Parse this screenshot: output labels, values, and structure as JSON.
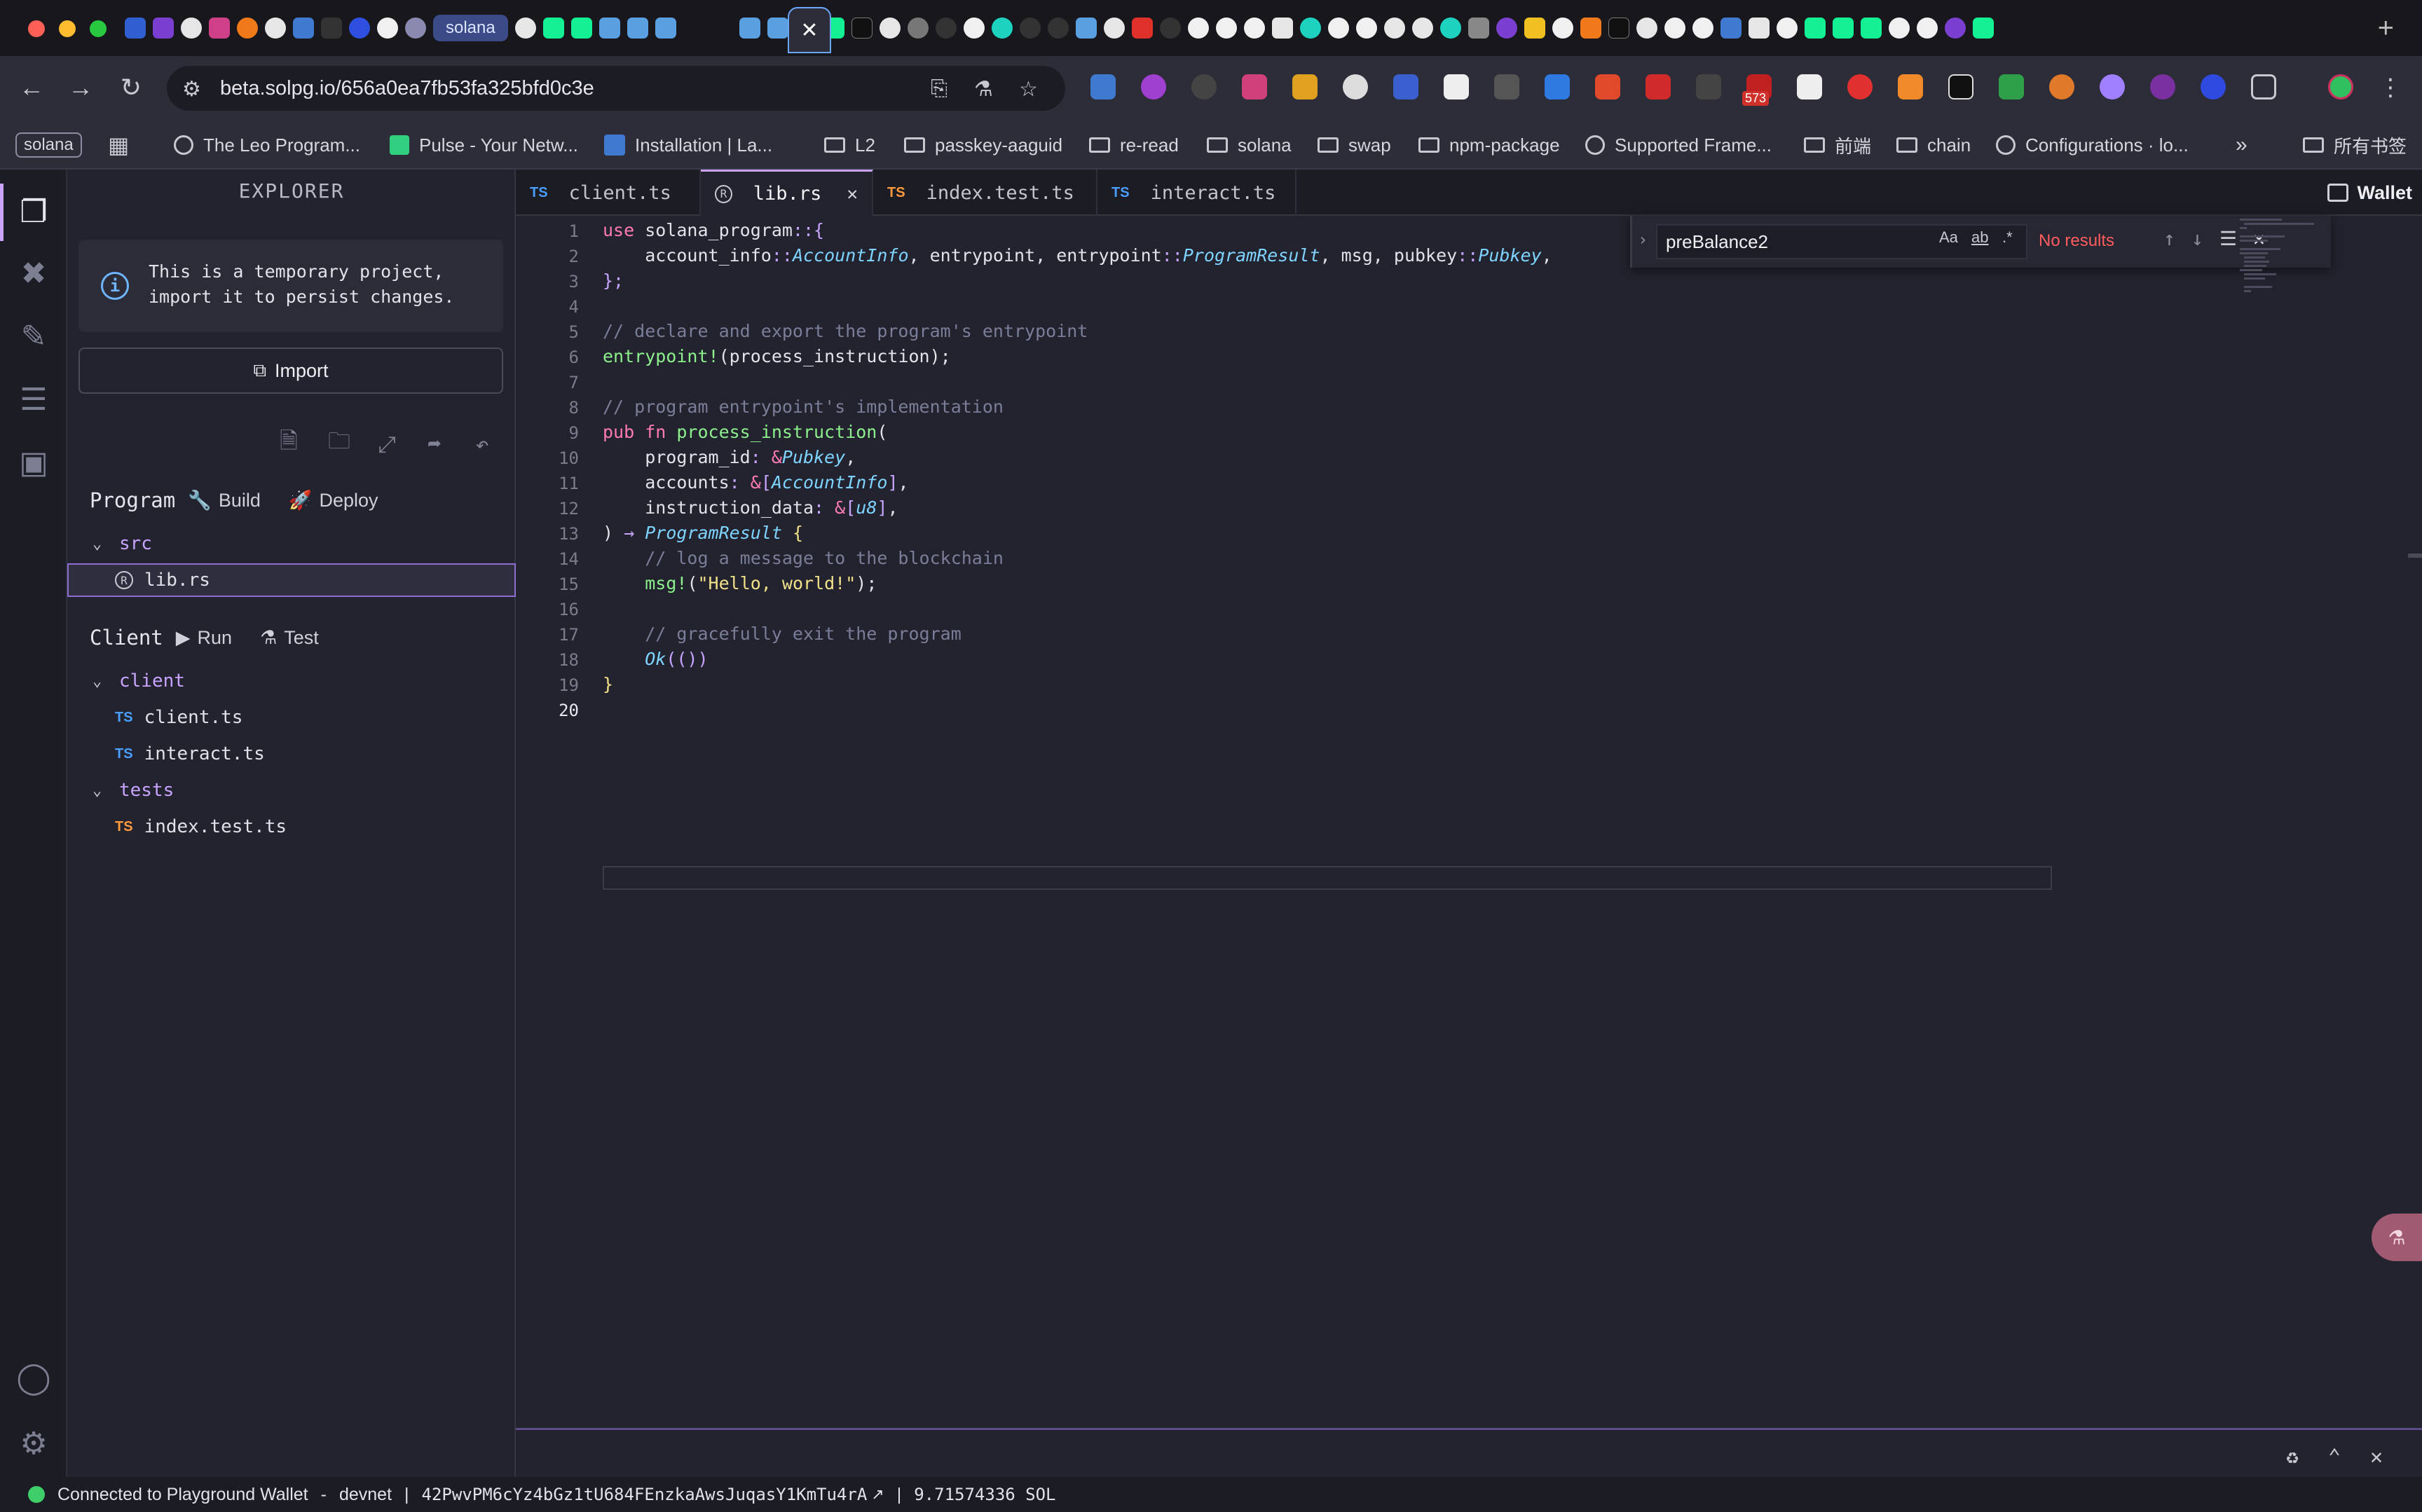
{
  "browser": {
    "solana_tab_label": "solana",
    "active_tab_close": "✕",
    "new_tab": "+",
    "url": "beta.solpg.io/656a0ea7fb53fa325bfd0c3e",
    "extension_badge": "573",
    "bookmarks": [
      {
        "label": "solana",
        "type": "chip"
      },
      {
        "label": "The Leo Program...",
        "type": "site"
      },
      {
        "label": "Pulse - Your Netw...",
        "type": "site"
      },
      {
        "label": "Installation | La...",
        "type": "site"
      },
      {
        "label": "L2",
        "type": "folder"
      },
      {
        "label": "passkey-aaguid",
        "type": "folder"
      },
      {
        "label": "re-read",
        "type": "folder"
      },
      {
        "label": "solana",
        "type": "folder"
      },
      {
        "label": "swap",
        "type": "folder"
      },
      {
        "label": "npm-package",
        "type": "folder"
      },
      {
        "label": "Supported Frame...",
        "type": "site"
      },
      {
        "label": "前端",
        "type": "folder"
      },
      {
        "label": "chain",
        "type": "folder"
      },
      {
        "label": "Configurations · lo...",
        "type": "site"
      },
      {
        "label": "所有书签",
        "type": "folder"
      }
    ]
  },
  "sidebar": {
    "title": "EXPLORER",
    "info_text": "This is a temporary project, import it to persist changes.",
    "import_label": "Import",
    "program_label": "Program",
    "build_label": "Build",
    "deploy_label": "Deploy",
    "src_folder": "src",
    "lib_file": "lib.rs",
    "client_label": "Client",
    "run_label": "Run",
    "test_label": "Test",
    "client_folder": "client",
    "client_file": "client.ts",
    "interact_file": "interact.ts",
    "tests_folder": "tests",
    "test_file": "index.test.ts",
    "ts_badge": "TS"
  },
  "editor": {
    "tabs": [
      {
        "label": "client.ts",
        "lang": "TS"
      },
      {
        "label": "lib.rs",
        "lang": "RS",
        "active": true
      },
      {
        "label": "index.test.ts",
        "lang": "TS"
      },
      {
        "label": "interact.ts",
        "lang": "TS"
      }
    ],
    "tab_close": "✕",
    "wallet_label": "Wallet",
    "find": {
      "query": "preBalance2",
      "result": "No results",
      "opt_case": "Aa",
      "opt_word": "ab",
      "opt_regex": ".*"
    },
    "line_numbers": [
      "1",
      "2",
      "3",
      "4",
      "5",
      "6",
      "7",
      "8",
      "9",
      "10",
      "11",
      "12",
      "13",
      "14",
      "15",
      "16",
      "17",
      "18",
      "19",
      "20"
    ]
  },
  "status": {
    "connection": "Connected to Playground Wallet",
    "sep1": "-",
    "network": "devnet",
    "sep2": "|",
    "address": "42PwvPM6cYz4bGz1tU684FEnzkaAwsJuqasY1KmTu4rA",
    "sep3": "|",
    "balance": "9.71574336 SOL"
  },
  "colors": {
    "accent": "#c8a4ff",
    "status_connected": "#3fcf6a",
    "find_no_results": "#ff5d5d"
  }
}
